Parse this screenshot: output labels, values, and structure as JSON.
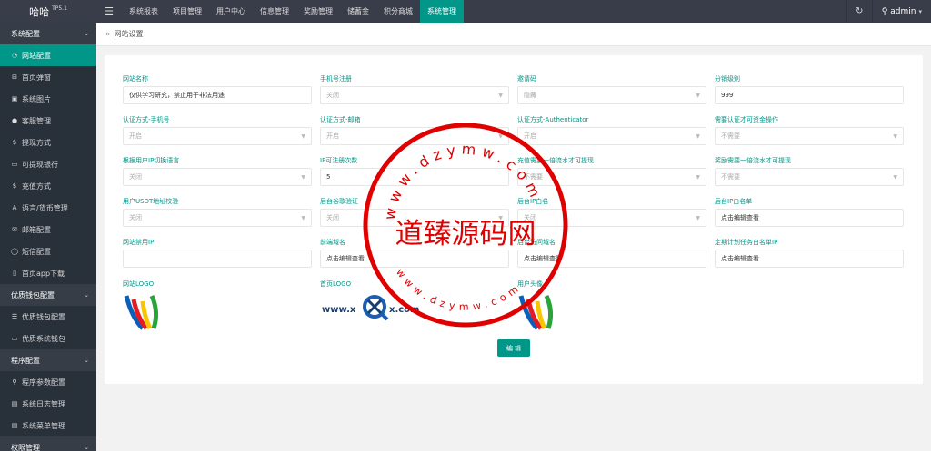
{
  "app": {
    "logo_text": "哈哈",
    "version": "TP5.1"
  },
  "topnav": {
    "toggle_icon": "menu-icon",
    "items": [
      {
        "label": "系统报表"
      },
      {
        "label": "项目管理"
      },
      {
        "label": "用户中心"
      },
      {
        "label": "信息管理"
      },
      {
        "label": "奖励管理"
      },
      {
        "label": "储蓄金"
      },
      {
        "label": "积分商城"
      },
      {
        "label": "系统管理",
        "active": true
      }
    ],
    "user": "admin"
  },
  "sidebar": {
    "groups": [
      {
        "title": "系统配置",
        "items": [
          {
            "label": "网站配置",
            "icon": "gauge-icon",
            "active": true
          },
          {
            "label": "首页弹窗",
            "icon": "window-icon"
          },
          {
            "label": "系统图片",
            "icon": "image-icon"
          },
          {
            "label": "客服管理",
            "icon": "chat-icon"
          },
          {
            "label": "提现方式",
            "icon": "dollar-icon"
          },
          {
            "label": "可提现银行",
            "icon": "card-icon"
          },
          {
            "label": "充值方式",
            "icon": "dollar-icon"
          },
          {
            "label": "语言/货币管理",
            "icon": "font-icon"
          },
          {
            "label": "邮箱配置",
            "icon": "mail-icon"
          },
          {
            "label": "短信配置",
            "icon": "message-icon"
          },
          {
            "label": "首页app下载",
            "icon": "mobile-icon"
          }
        ]
      },
      {
        "title": "优质钱包配置",
        "items": [
          {
            "label": "优质钱包配置",
            "icon": "list-icon"
          },
          {
            "label": "优质系统钱包",
            "icon": "card-icon"
          }
        ]
      },
      {
        "title": "程序配置",
        "items": [
          {
            "label": "程序参数配置",
            "icon": "link-icon"
          },
          {
            "label": "系统日志管理",
            "icon": "doc-icon"
          },
          {
            "label": "系统菜单管理",
            "icon": "doc-icon"
          }
        ]
      },
      {
        "title": "权限管理",
        "items": []
      }
    ]
  },
  "breadcrumb": {
    "current": "网站设置"
  },
  "form": {
    "rows": [
      [
        {
          "label": "网站名称",
          "type": "text",
          "value": "仅供学习研究，禁止用于非法用途"
        },
        {
          "label": "手机号注册",
          "type": "select",
          "value": "关闭"
        },
        {
          "label": "邀请码",
          "type": "select",
          "value": "隐藏"
        },
        {
          "label": "分销级别",
          "type": "text",
          "value": "999"
        }
      ],
      [
        {
          "label": "认证方式-手机号",
          "type": "select",
          "value": "开启"
        },
        {
          "label": "认证方式-邮箱",
          "type": "select",
          "value": "开启"
        },
        {
          "label": "认证方式-Authenticator",
          "type": "select",
          "value": "开启"
        },
        {
          "label": "需要认证才可资金操作",
          "type": "select",
          "value": "不需要"
        }
      ],
      [
        {
          "label": "根据用户IP切换语言",
          "type": "select",
          "value": "关闭"
        },
        {
          "label": "IP可注册次数",
          "type": "text",
          "value": "5"
        },
        {
          "label": "充值需要一倍流水才可提现",
          "type": "select",
          "value": "不需要"
        },
        {
          "label": "奖励需要一倍流水才可提现",
          "type": "select",
          "value": "不需要"
        }
      ],
      [
        {
          "label": "用户USDT地址校验",
          "type": "select",
          "value": "关闭"
        },
        {
          "label": "后台谷歌验证",
          "type": "select",
          "value": "关闭"
        },
        {
          "label": "后台IP白名",
          "type": "select",
          "value": "关闭"
        },
        {
          "label": "后台IP白名单",
          "type": "text",
          "value": "点击编辑查看"
        }
      ],
      [
        {
          "label": "网站禁用IP",
          "type": "text",
          "value": ""
        },
        {
          "label": "前端域名",
          "type": "text",
          "value": "点击编辑查看"
        },
        {
          "label": "后台访问域名",
          "type": "text",
          "value": "点击编辑查看"
        },
        {
          "label": "定期计划任务白名单IP",
          "type": "text",
          "value": "点击编辑查看"
        }
      ]
    ],
    "logos": [
      {
        "label": "网站LOGO"
      },
      {
        "label": "首页LOGO"
      },
      {
        "label": "用户头像"
      }
    ],
    "edit_button": "编 辑"
  },
  "watermark": {
    "center_text": "道臻源码网",
    "arc_top": "www.dzymw.com",
    "arc_bottom": "www.dzymw.com",
    "logo2_text_left": "www.x",
    "logo2_text_right": "x.com",
    "color": "#e00000"
  }
}
